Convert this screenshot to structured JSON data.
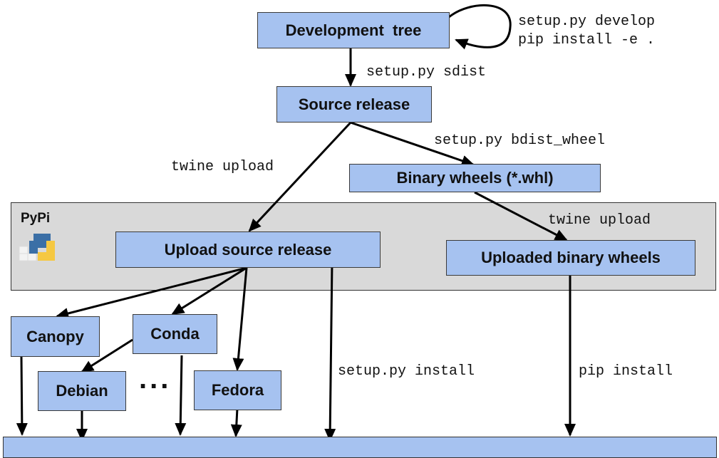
{
  "nodes": {
    "dev_tree": "Development  tree",
    "source_release": "Source release",
    "binary_wheels": "Binary wheels (*.whl)",
    "upload_source": "Upload source release",
    "uploaded_wheels": "Uploaded binary wheels",
    "canopy": "Canopy",
    "conda": "Conda",
    "debian": "Debian",
    "fedora": "Fedora",
    "ellipsis": "..."
  },
  "group": {
    "title": "PyPi",
    "icon": "python-logo-icon"
  },
  "edges": {
    "develop": "setup.py develop\npip install -e .",
    "sdist": "setup.py sdist",
    "bdist_wheel": "setup.py bdist_wheel",
    "twine_upload_source": "twine upload",
    "twine_upload_wheels": "twine upload",
    "setup_install": "setup.py install",
    "pip_install": "pip install"
  },
  "colors": {
    "node_fill": "#a6c2f0",
    "group_fill": "#d9d9d9",
    "stroke": "#000000"
  }
}
